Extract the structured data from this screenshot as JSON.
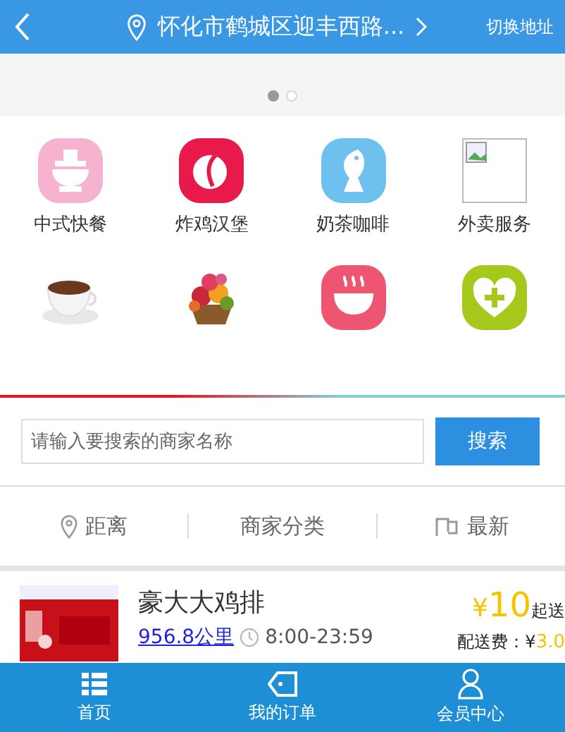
{
  "header": {
    "location": "怀化市鹤城区迎丰西路...",
    "switch_label": "切换地址"
  },
  "carousel_dots": [
    {
      "selected": true
    },
    {
      "selected": false
    }
  ],
  "categories": [
    {
      "kind": "pot",
      "label": "中式快餐",
      "color": "#f5b3cf"
    },
    {
      "kind": "leaf",
      "label": "炸鸡汉堡",
      "color": "#e8194b"
    },
    {
      "kind": "fish",
      "label": "奶茶咖啡",
      "color": "#6ec1ee"
    },
    {
      "kind": "broken",
      "label": "外卖服务"
    },
    {
      "kind": "cup"
    },
    {
      "kind": "basket"
    },
    {
      "kind": "bowl",
      "color": "#ee5570"
    },
    {
      "kind": "heart",
      "color": "#a6c81c"
    }
  ],
  "search": {
    "placeholder": "请输入要搜索的商家名称",
    "button": "搜索"
  },
  "sort_tabs": [
    {
      "kind": "pin",
      "label": "距离"
    },
    {
      "kind": "none",
      "label": "商家分类"
    },
    {
      "kind": "flag",
      "label": "最新"
    }
  ],
  "shop": {
    "name": "豪大大鸡排",
    "distance": "956.8公里",
    "hours": "8:00-23:59",
    "currency": "¥",
    "min_price": "10",
    "min_label": "起送",
    "fee_label": "配送费：¥",
    "fee": "3.0"
  },
  "nav": [
    {
      "kind": "grid",
      "label": "首页"
    },
    {
      "kind": "tag",
      "label": "我的订单"
    },
    {
      "kind": "person",
      "label": "会员中心"
    }
  ]
}
